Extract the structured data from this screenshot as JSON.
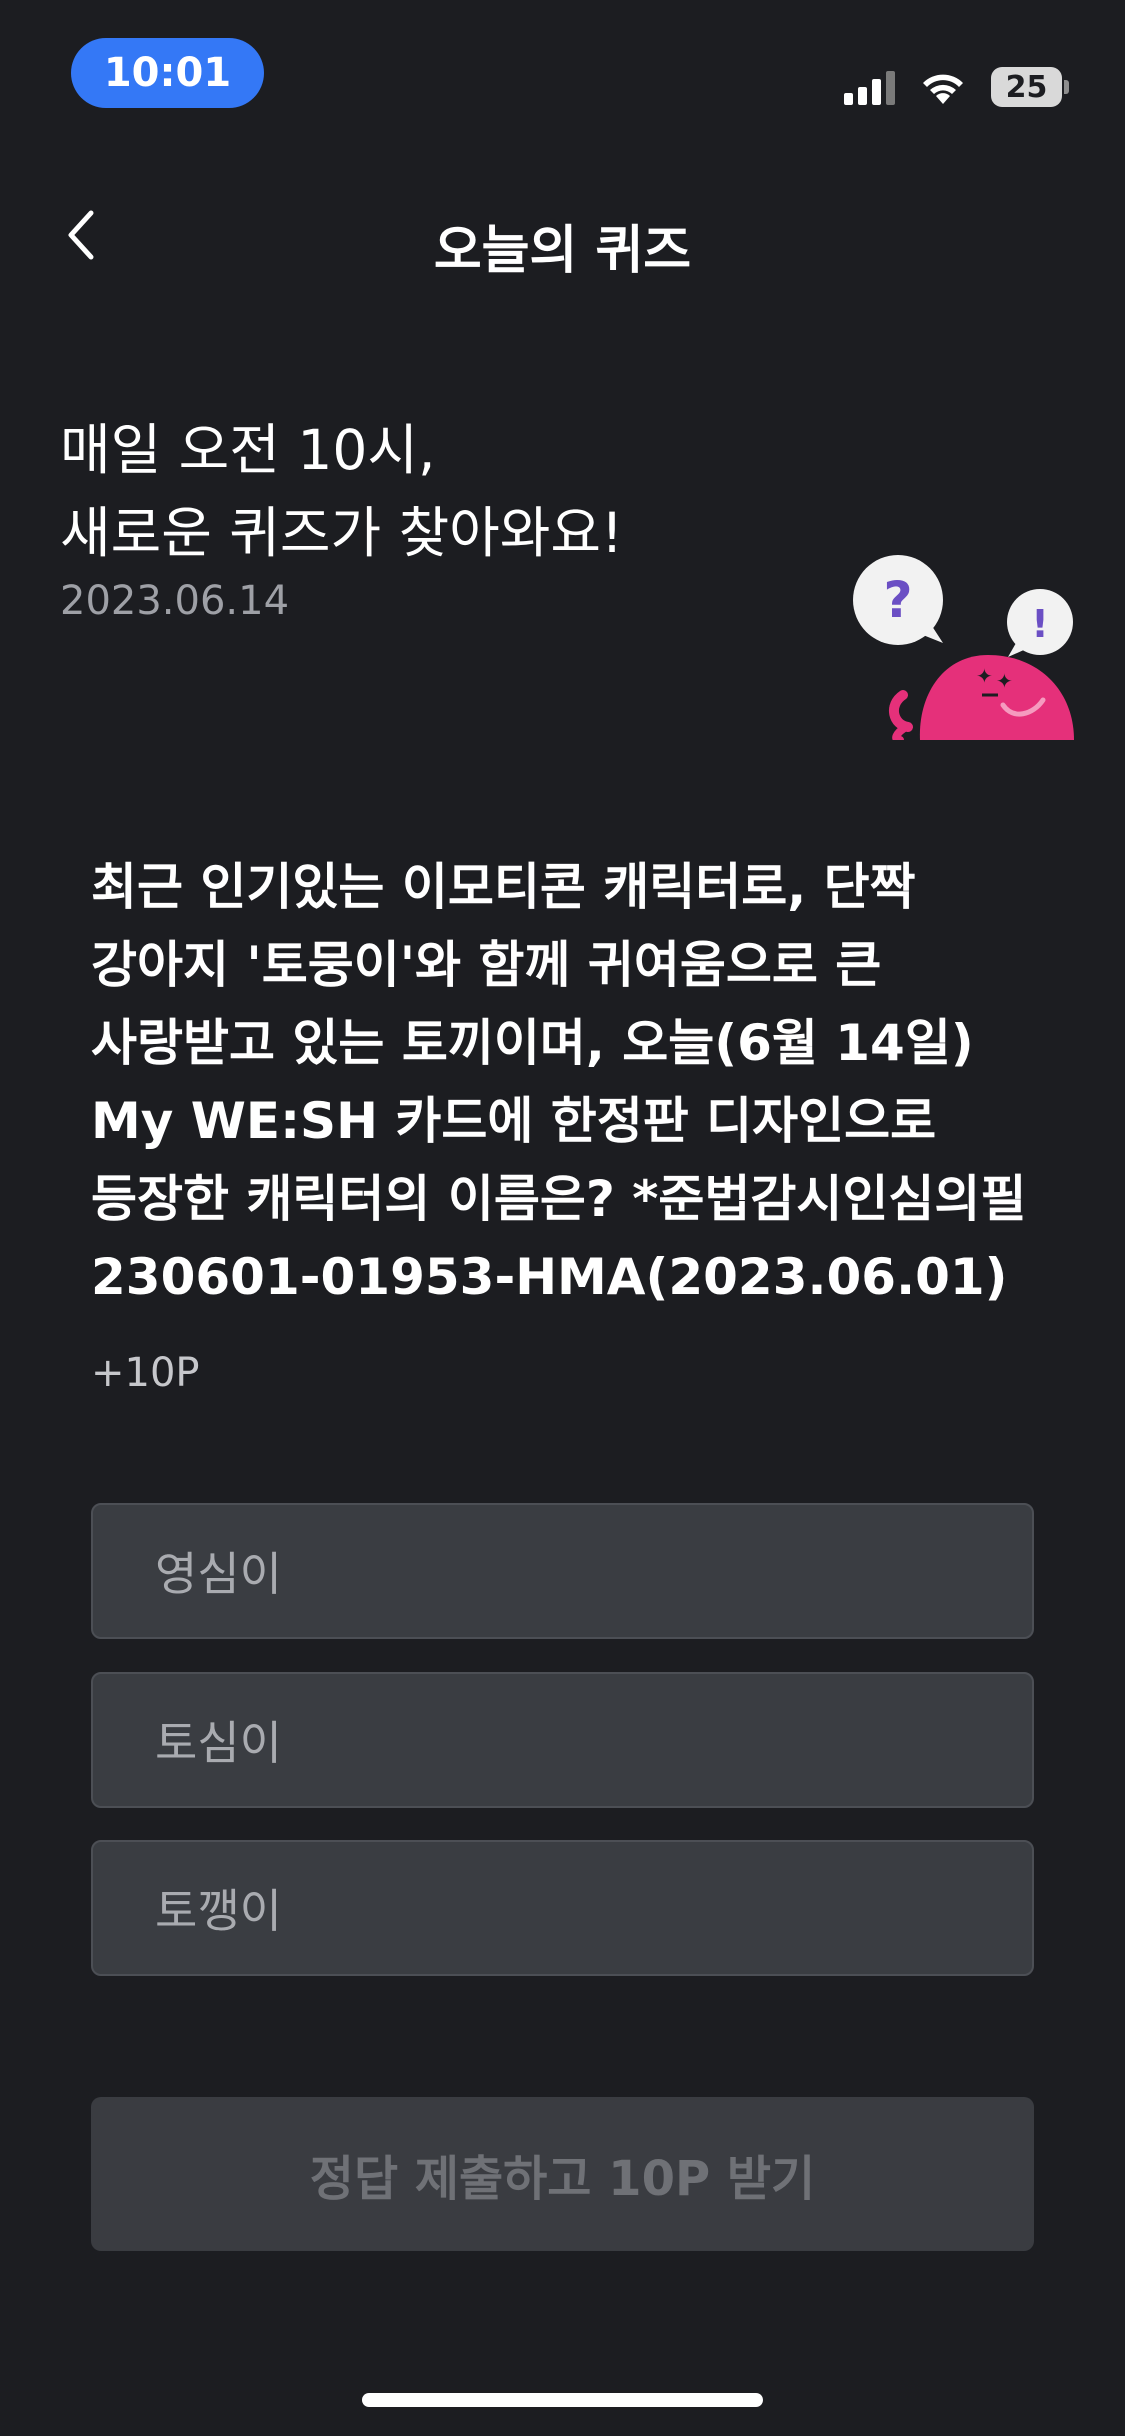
{
  "status_bar": {
    "time": "10:01",
    "battery": "25",
    "icons": [
      "signal-icon",
      "wifi-icon",
      "battery-icon"
    ]
  },
  "nav": {
    "title": "오늘의 퀴즈",
    "back_icon": "chevron-left-icon"
  },
  "intro": {
    "line1": "매일 오전 10시,",
    "line2": "새로운 퀴즈가 찾아와요!",
    "date": "2023.06.14"
  },
  "quiz": {
    "question": "최근 인기있는 이모티콘 캐릭터로, 단짝 강아지 '토뭉이'와 함께 귀여움으로 큰 사랑받고 있는 토끼이며, 오늘(6월 14일) My WE:SH 카드에 한정판 디자인으로 등장한 캐릭터의 이름은? *준법감시인심의필 230601-01953-HMA(2023.06.01)",
    "points": "+10P",
    "options": [
      {
        "label": "영심이"
      },
      {
        "label": "토심이"
      },
      {
        "label": "토깽이"
      }
    ],
    "submit_label": "정답 제출하고 10P 받기"
  },
  "colors": {
    "background": "#1c1d21",
    "time_pill": "#3478f6",
    "option_bg": "#3a3d42",
    "mascot_pink": "#e5307a",
    "bubble_purple": "#6b4fc4"
  }
}
